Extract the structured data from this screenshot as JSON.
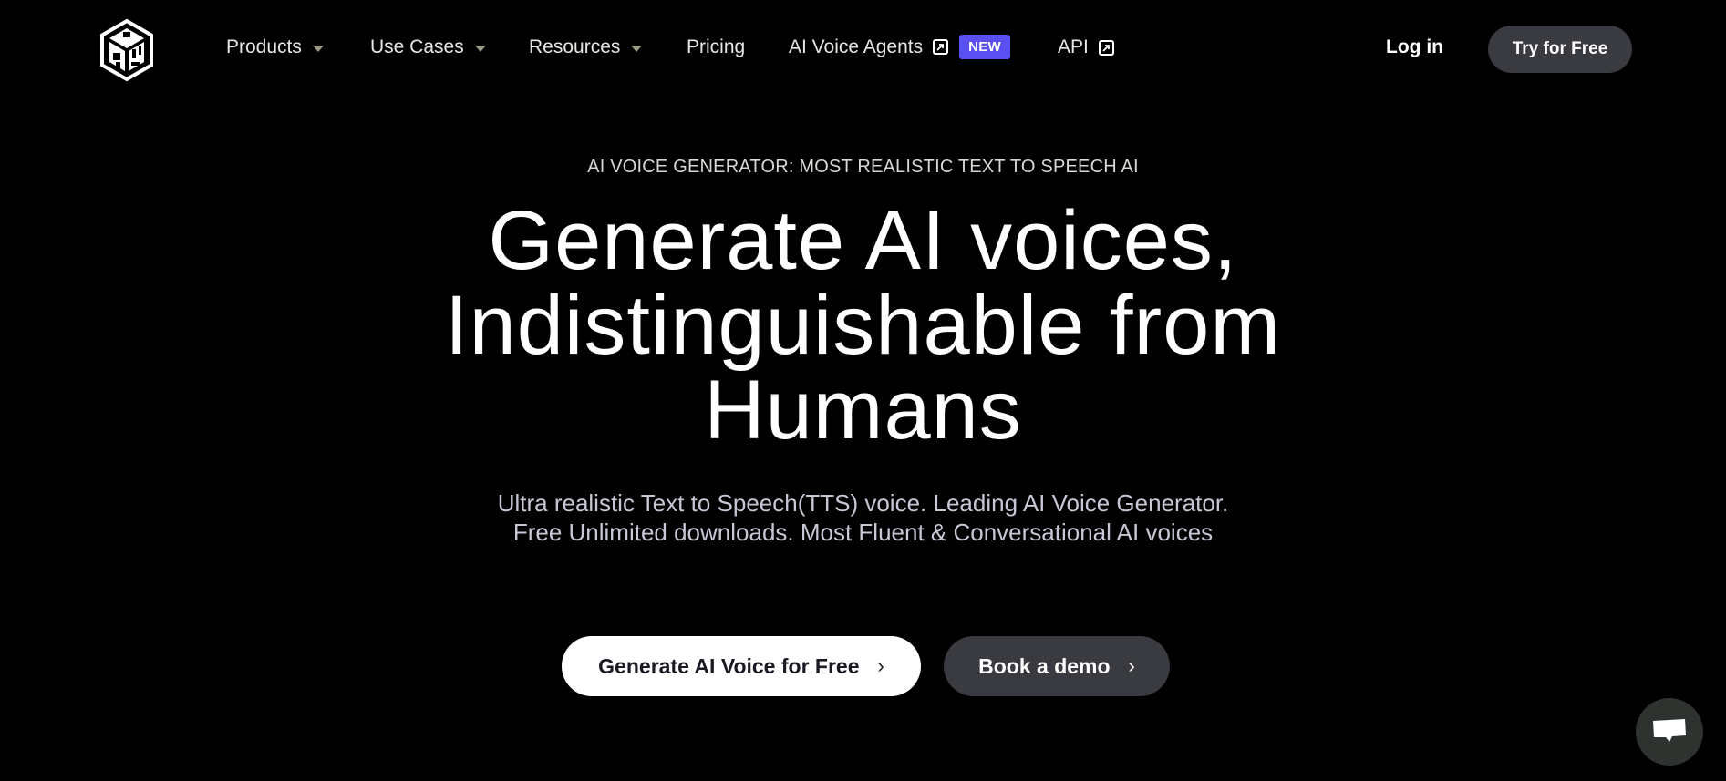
{
  "nav": {
    "logo_icon": "playht-cube-logo",
    "items": [
      {
        "label": "Products",
        "icon": "caret-down-icon"
      },
      {
        "label": "Use Cases",
        "icon": "caret-down-icon"
      },
      {
        "label": "Resources",
        "icon": "caret-down-icon"
      },
      {
        "label": "Pricing"
      },
      {
        "label": "AI Voice Agents",
        "icon": "external-link-icon",
        "badge": "NEW"
      },
      {
        "label": "API",
        "icon": "external-link-icon"
      }
    ],
    "login_label": "Log in",
    "try_label": "Try for Free"
  },
  "hero": {
    "tagline": "AI VOICE GENERATOR: MOST REALISTIC TEXT TO SPEECH AI",
    "headline_lines": [
      "Generate AI voices,",
      "Indistinguishable from",
      "Humans"
    ],
    "subtitle_lines": [
      "Ultra realistic Text to Speech(TTS) voice. Leading AI Voice Generator.",
      "Free Unlimited downloads. Most Fluent & Conversational AI voices"
    ],
    "primary_cta": "Generate AI Voice for Free",
    "secondary_cta": "Book a demo",
    "chevron": "›"
  },
  "chat_widget": {
    "icon": "chat-bubble-icon"
  },
  "colors": {
    "background": "#000000",
    "badge": "#5a4ff0",
    "dark_button": "#3a3b40",
    "chat_button": "#2f3330"
  }
}
